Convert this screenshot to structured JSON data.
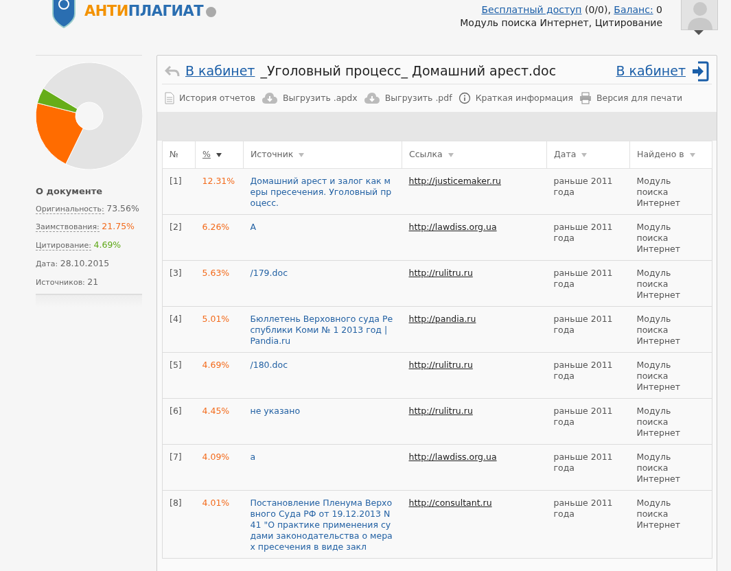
{
  "header": {
    "logo": [
      "АНТИ",
      "ПЛАГИАТ"
    ],
    "account": {
      "free_access_link": "Бесплатный доступ",
      "free_access_count": "(0/0),",
      "balance_link": "Баланс:",
      "balance": "0",
      "modules": "Модуль поиска Интернет, Цитирование"
    }
  },
  "sidebar": {
    "title": "О документе",
    "stats": [
      {
        "kind": "originality",
        "label": "Оригинальность:",
        "value": "73.56%"
      },
      {
        "kind": "borrowing",
        "label": "Заимствования:",
        "value": "21.75%"
      },
      {
        "kind": "citation",
        "label": "Цитирование:",
        "value": "4.69%"
      },
      {
        "kind": "plain",
        "label": "Дата:",
        "value": "28.10.2015"
      },
      {
        "kind": "plain",
        "label": "Источников:",
        "value": "21"
      }
    ]
  },
  "report": {
    "back_link": "В кабинет",
    "document_title": "_Уголовный процесс_ Домашний арест.doc",
    "cabinet_link": "В кабинет",
    "toolbar": [
      {
        "kind": "history",
        "label": "История отчетов"
      },
      {
        "kind": "download",
        "label": "Выгрузить .apdx"
      },
      {
        "kind": "download",
        "label": "Выгрузить .pdf"
      },
      {
        "kind": "info",
        "label": "Краткая информация"
      },
      {
        "kind": "print",
        "label": "Версия для печати"
      }
    ],
    "table": {
      "columns": [
        {
          "label": "№",
          "sortable": false,
          "selected": false
        },
        {
          "label": "%",
          "sortable": true,
          "selected": true
        },
        {
          "label": "Источник",
          "sortable": true,
          "selected": false
        },
        {
          "label": "Ссылка",
          "sortable": true,
          "selected": false
        },
        {
          "label": "Дата",
          "sortable": true,
          "selected": false
        },
        {
          "label": "Найдено в",
          "sortable": true,
          "selected": false
        }
      ],
      "rows": [
        {
          "num": "[1]",
          "percent": "12.31%",
          "source": "Домашний арест и залог как меры пресечения. Уголовный процесс.",
          "link": "http://justicemaker.ru",
          "date": "раньше 2011 года",
          "found_in": "Модуль поиска Интернет"
        },
        {
          "num": "[2]",
          "percent": "6.26%",
          "source": "А",
          "link": "http://lawdiss.org.ua",
          "date": "раньше 2011 года",
          "found_in": "Модуль поиска Интернет"
        },
        {
          "num": "[3]",
          "percent": "5.63%",
          "source": "/179.doc",
          "link": "http://rulitru.ru",
          "date": "раньше 2011 года",
          "found_in": "Модуль поиска Интернет"
        },
        {
          "num": "[4]",
          "percent": "5.01%",
          "source": "Бюллетень Верховного суда Республики Коми № 1 2013 год | Pandia.ru",
          "link": "http://pandia.ru",
          "date": "раньше 2011 года",
          "found_in": "Модуль поиска Интернет"
        },
        {
          "num": "[5]",
          "percent": "4.69%",
          "source": "/180.doc",
          "link": "http://rulitru.ru",
          "date": "раньше 2011 года",
          "found_in": "Модуль поиска Интернет"
        },
        {
          "num": "[6]",
          "percent": "4.45%",
          "source": "не указано",
          "link": "http://rulitru.ru",
          "date": "раньше 2011 года",
          "found_in": "Модуль поиска Интернет"
        },
        {
          "num": "[7]",
          "percent": "4.09%",
          "source": "а",
          "link": "http://lawdiss.org.ua",
          "date": "раньше 2011 года",
          "found_in": "Модуль поиска Интернет"
        },
        {
          "num": "[8]",
          "percent": "4.01%",
          "source": "Постановление Пленума Верховного Суда РФ от 19.12.2013 N 41 \"О практике применения судами законодательства о мерах пресечения в виде закл",
          "link": "http://consultant.ru",
          "date": "раньше 2011 года",
          "found_in": "Модуль поиска Интернет"
        }
      ]
    }
  }
}
